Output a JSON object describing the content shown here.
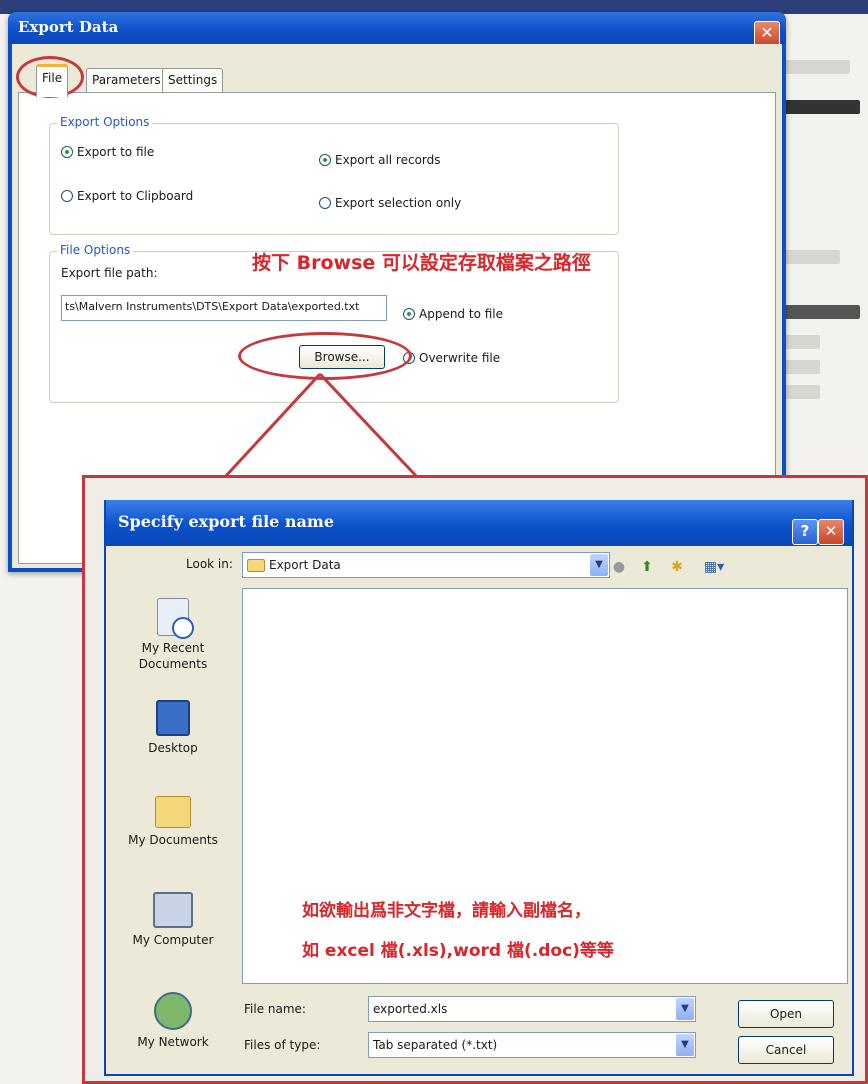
{
  "export_window": {
    "title": "Export Data",
    "close_label": "✕",
    "tabs": [
      {
        "label": "File"
      },
      {
        "label": "Parameters"
      },
      {
        "label": "Settings"
      }
    ],
    "export_options": {
      "label": "Export Options",
      "export_to_file": "Export to file",
      "export_to_clipboard": "Export to Clipboard",
      "export_all_records": "Export all records",
      "export_selection_only": "Export selection only"
    },
    "file_options": {
      "label": "File Options",
      "path_label": "Export file path:",
      "path_value": "ts\\Malvern Instruments\\DTS\\Export Data\\exported.txt",
      "append_label": "Append to file",
      "overwrite_label": "Overwrite file",
      "browse_label": "Browse..."
    }
  },
  "annotations": {
    "browse_note": "按下 Browse 可以設定存取檔案之路徑",
    "ext_note_line1": "如欲輸出爲非文字檔，請輸入副檔名，",
    "ext_note_line2": "如 excel 檔(.xls),word 檔(.doc)等等"
  },
  "dialog": {
    "title": "Specify export file name",
    "help_label": "?",
    "close_label": "✕",
    "look_in_label": "Look in:",
    "look_in_value": "Export Data",
    "places": [
      {
        "label": "My Recent Documents"
      },
      {
        "label": "Desktop"
      },
      {
        "label": "My Documents"
      },
      {
        "label": "My Computer"
      },
      {
        "label": "My Network"
      }
    ],
    "file_name_label": "File name:",
    "file_name_value": "exported.xls",
    "file_type_label": "Files of type:",
    "file_type_value": "Tab separated (*.txt)",
    "open_label": "Open",
    "cancel_label": "Cancel"
  },
  "colors": {
    "title_bar": "#0a4fc4",
    "annotation_red": "#d9262a",
    "highlight_ellipse": "#c4383e"
  }
}
